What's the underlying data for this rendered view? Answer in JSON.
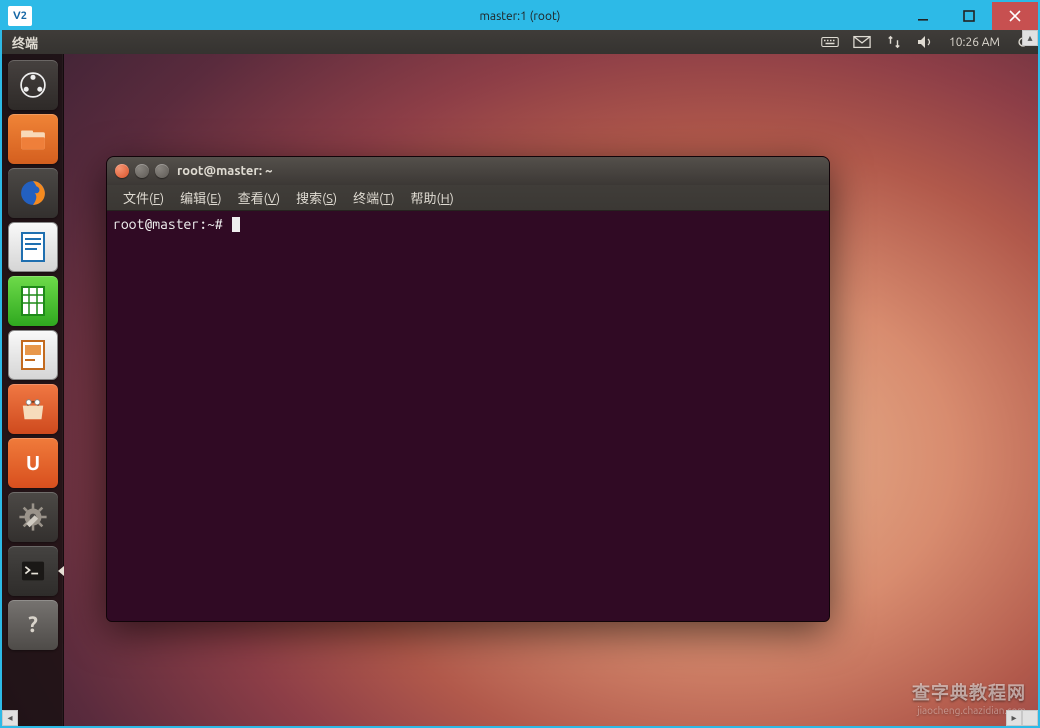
{
  "vnc": {
    "logo_text": "V2",
    "title": "master:1 (root)",
    "controls": {
      "minimize": "minimize",
      "maximize": "maximize",
      "close": "close"
    }
  },
  "ubuntu_panel": {
    "active_app": "终端",
    "indicators": {
      "keyboard": "keyboard-icon",
      "mail": "mail-icon",
      "network": "network-icon",
      "sound": "sound-icon",
      "clock": "10:26 AM",
      "session": "session-icon"
    }
  },
  "launcher": [
    {
      "name": "dash-home",
      "label": "Dash 主页"
    },
    {
      "name": "files",
      "label": "主文件夹"
    },
    {
      "name": "firefox",
      "label": "Firefox"
    },
    {
      "name": "libreoffice-writer",
      "label": "LibreOffice Writer"
    },
    {
      "name": "libreoffice-calc",
      "label": "LibreOffice Calc"
    },
    {
      "name": "libreoffice-impress",
      "label": "LibreOffice Impress"
    },
    {
      "name": "software-center",
      "label": "Ubuntu 软件中心"
    },
    {
      "name": "ubuntu-one",
      "label": "Ubuntu One"
    },
    {
      "name": "system-settings",
      "label": "系统设置"
    },
    {
      "name": "terminal",
      "label": "终端",
      "active": true
    },
    {
      "name": "help",
      "label": "帮助"
    }
  ],
  "terminal": {
    "window_title": "root@master: ~",
    "menus": [
      {
        "label": "文件(F)",
        "hot": "F"
      },
      {
        "label": "编辑(E)",
        "hot": "E"
      },
      {
        "label": "查看(V)",
        "hot": "V"
      },
      {
        "label": "搜索(S)",
        "hot": "S"
      },
      {
        "label": "终端(T)",
        "hot": "T"
      },
      {
        "label": "帮助(H)",
        "hot": "H"
      }
    ],
    "prompt": "root@master:~# "
  },
  "watermark": {
    "line1": "查字典教程网",
    "line2": "jiaocheng.chazidian.com"
  }
}
